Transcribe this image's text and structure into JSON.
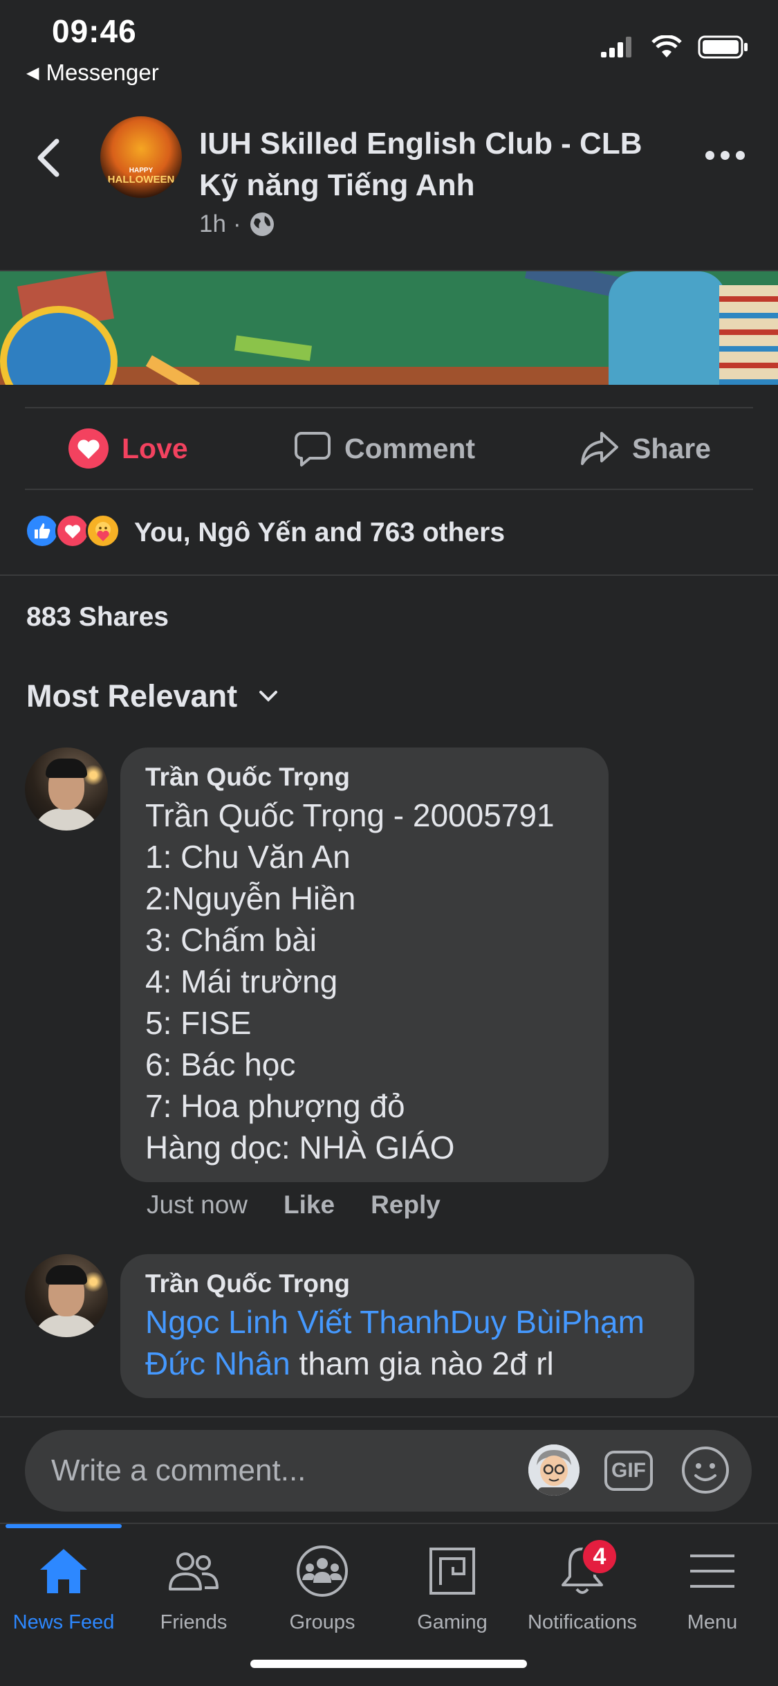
{
  "status_bar": {
    "time": "09:46",
    "back_app": "Messenger"
  },
  "header": {
    "page_name": "IUH Skilled English Club - CLB Kỹ năng Tiếng Anh",
    "time_ago": "1h",
    "privacy_icon": "globe-icon",
    "avatar_text": "HALLOWEEN",
    "avatar_small": "HAPPY"
  },
  "actions": {
    "love": "Love",
    "comment": "Comment",
    "share": "Share"
  },
  "reactions": {
    "summary": "You, Ngô Yến and 763 others",
    "icons": [
      "like",
      "love",
      "care"
    ]
  },
  "shares": "883 Shares",
  "sort": {
    "label": "Most Relevant"
  },
  "comments": [
    {
      "author": "Trần Quốc Trọng",
      "text": "Trần Quốc Trọng - 20005791\n1: Chu Văn An\n2:Nguyễn Hiền\n3: Chấm bài\n4: Mái trường\n5: FISE\n6: Bác học\n7: Hoa phượng đỏ\nHàng dọc: NHÀ GIÁO",
      "time": "Just now",
      "like": "Like",
      "reply": "Reply"
    },
    {
      "author": "Trần Quốc Trọng",
      "mentions": "Ngọc Linh Viết ThanhDuy BùiPhạm Đức Nhân",
      "text": " tham gia nào 2đ rl"
    }
  ],
  "composer": {
    "placeholder": "Write a comment...",
    "gif": "GIF"
  },
  "tabs": [
    {
      "label": "News Feed",
      "icon": "home-icon",
      "active": true
    },
    {
      "label": "Friends",
      "icon": "friends-icon"
    },
    {
      "label": "Groups",
      "icon": "groups-icon"
    },
    {
      "label": "Gaming",
      "icon": "gaming-icon"
    },
    {
      "label": "Notifications",
      "icon": "bell-icon",
      "badge": "4"
    },
    {
      "label": "Menu",
      "icon": "menu-icon"
    }
  ],
  "colors": {
    "accent": "#2d88ff",
    "love": "#f3425f",
    "mention": "#4599ff",
    "background": "#242526",
    "bubble": "#3a3b3c"
  }
}
